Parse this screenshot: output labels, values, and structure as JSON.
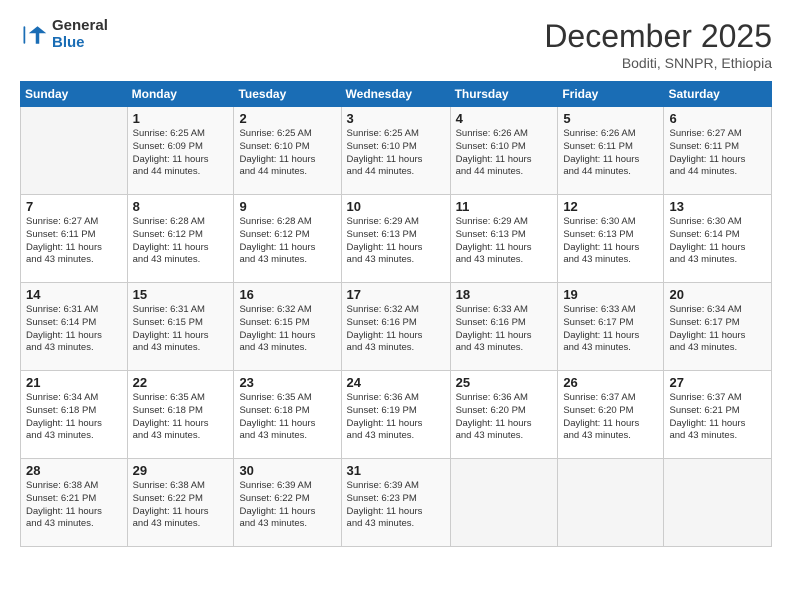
{
  "logo": {
    "general": "General",
    "blue": "Blue"
  },
  "title": "December 2025",
  "subtitle": "Boditi, SNNPR, Ethiopia",
  "days_header": [
    "Sunday",
    "Monday",
    "Tuesday",
    "Wednesday",
    "Thursday",
    "Friday",
    "Saturday"
  ],
  "weeks": [
    [
      {
        "num": "",
        "info": ""
      },
      {
        "num": "1",
        "info": "Sunrise: 6:25 AM\nSunset: 6:09 PM\nDaylight: 11 hours\nand 44 minutes."
      },
      {
        "num": "2",
        "info": "Sunrise: 6:25 AM\nSunset: 6:10 PM\nDaylight: 11 hours\nand 44 minutes."
      },
      {
        "num": "3",
        "info": "Sunrise: 6:25 AM\nSunset: 6:10 PM\nDaylight: 11 hours\nand 44 minutes."
      },
      {
        "num": "4",
        "info": "Sunrise: 6:26 AM\nSunset: 6:10 PM\nDaylight: 11 hours\nand 44 minutes."
      },
      {
        "num": "5",
        "info": "Sunrise: 6:26 AM\nSunset: 6:11 PM\nDaylight: 11 hours\nand 44 minutes."
      },
      {
        "num": "6",
        "info": "Sunrise: 6:27 AM\nSunset: 6:11 PM\nDaylight: 11 hours\nand 44 minutes."
      }
    ],
    [
      {
        "num": "7",
        "info": "Sunrise: 6:27 AM\nSunset: 6:11 PM\nDaylight: 11 hours\nand 43 minutes."
      },
      {
        "num": "8",
        "info": "Sunrise: 6:28 AM\nSunset: 6:12 PM\nDaylight: 11 hours\nand 43 minutes."
      },
      {
        "num": "9",
        "info": "Sunrise: 6:28 AM\nSunset: 6:12 PM\nDaylight: 11 hours\nand 43 minutes."
      },
      {
        "num": "10",
        "info": "Sunrise: 6:29 AM\nSunset: 6:13 PM\nDaylight: 11 hours\nand 43 minutes."
      },
      {
        "num": "11",
        "info": "Sunrise: 6:29 AM\nSunset: 6:13 PM\nDaylight: 11 hours\nand 43 minutes."
      },
      {
        "num": "12",
        "info": "Sunrise: 6:30 AM\nSunset: 6:13 PM\nDaylight: 11 hours\nand 43 minutes."
      },
      {
        "num": "13",
        "info": "Sunrise: 6:30 AM\nSunset: 6:14 PM\nDaylight: 11 hours\nand 43 minutes."
      }
    ],
    [
      {
        "num": "14",
        "info": "Sunrise: 6:31 AM\nSunset: 6:14 PM\nDaylight: 11 hours\nand 43 minutes."
      },
      {
        "num": "15",
        "info": "Sunrise: 6:31 AM\nSunset: 6:15 PM\nDaylight: 11 hours\nand 43 minutes."
      },
      {
        "num": "16",
        "info": "Sunrise: 6:32 AM\nSunset: 6:15 PM\nDaylight: 11 hours\nand 43 minutes."
      },
      {
        "num": "17",
        "info": "Sunrise: 6:32 AM\nSunset: 6:16 PM\nDaylight: 11 hours\nand 43 minutes."
      },
      {
        "num": "18",
        "info": "Sunrise: 6:33 AM\nSunset: 6:16 PM\nDaylight: 11 hours\nand 43 minutes."
      },
      {
        "num": "19",
        "info": "Sunrise: 6:33 AM\nSunset: 6:17 PM\nDaylight: 11 hours\nand 43 minutes."
      },
      {
        "num": "20",
        "info": "Sunrise: 6:34 AM\nSunset: 6:17 PM\nDaylight: 11 hours\nand 43 minutes."
      }
    ],
    [
      {
        "num": "21",
        "info": "Sunrise: 6:34 AM\nSunset: 6:18 PM\nDaylight: 11 hours\nand 43 minutes."
      },
      {
        "num": "22",
        "info": "Sunrise: 6:35 AM\nSunset: 6:18 PM\nDaylight: 11 hours\nand 43 minutes."
      },
      {
        "num": "23",
        "info": "Sunrise: 6:35 AM\nSunset: 6:18 PM\nDaylight: 11 hours\nand 43 minutes."
      },
      {
        "num": "24",
        "info": "Sunrise: 6:36 AM\nSunset: 6:19 PM\nDaylight: 11 hours\nand 43 minutes."
      },
      {
        "num": "25",
        "info": "Sunrise: 6:36 AM\nSunset: 6:20 PM\nDaylight: 11 hours\nand 43 minutes."
      },
      {
        "num": "26",
        "info": "Sunrise: 6:37 AM\nSunset: 6:20 PM\nDaylight: 11 hours\nand 43 minutes."
      },
      {
        "num": "27",
        "info": "Sunrise: 6:37 AM\nSunset: 6:21 PM\nDaylight: 11 hours\nand 43 minutes."
      }
    ],
    [
      {
        "num": "28",
        "info": "Sunrise: 6:38 AM\nSunset: 6:21 PM\nDaylight: 11 hours\nand 43 minutes."
      },
      {
        "num": "29",
        "info": "Sunrise: 6:38 AM\nSunset: 6:22 PM\nDaylight: 11 hours\nand 43 minutes."
      },
      {
        "num": "30",
        "info": "Sunrise: 6:39 AM\nSunset: 6:22 PM\nDaylight: 11 hours\nand 43 minutes."
      },
      {
        "num": "31",
        "info": "Sunrise: 6:39 AM\nSunset: 6:23 PM\nDaylight: 11 hours\nand 43 minutes."
      },
      {
        "num": "",
        "info": ""
      },
      {
        "num": "",
        "info": ""
      },
      {
        "num": "",
        "info": ""
      }
    ]
  ]
}
